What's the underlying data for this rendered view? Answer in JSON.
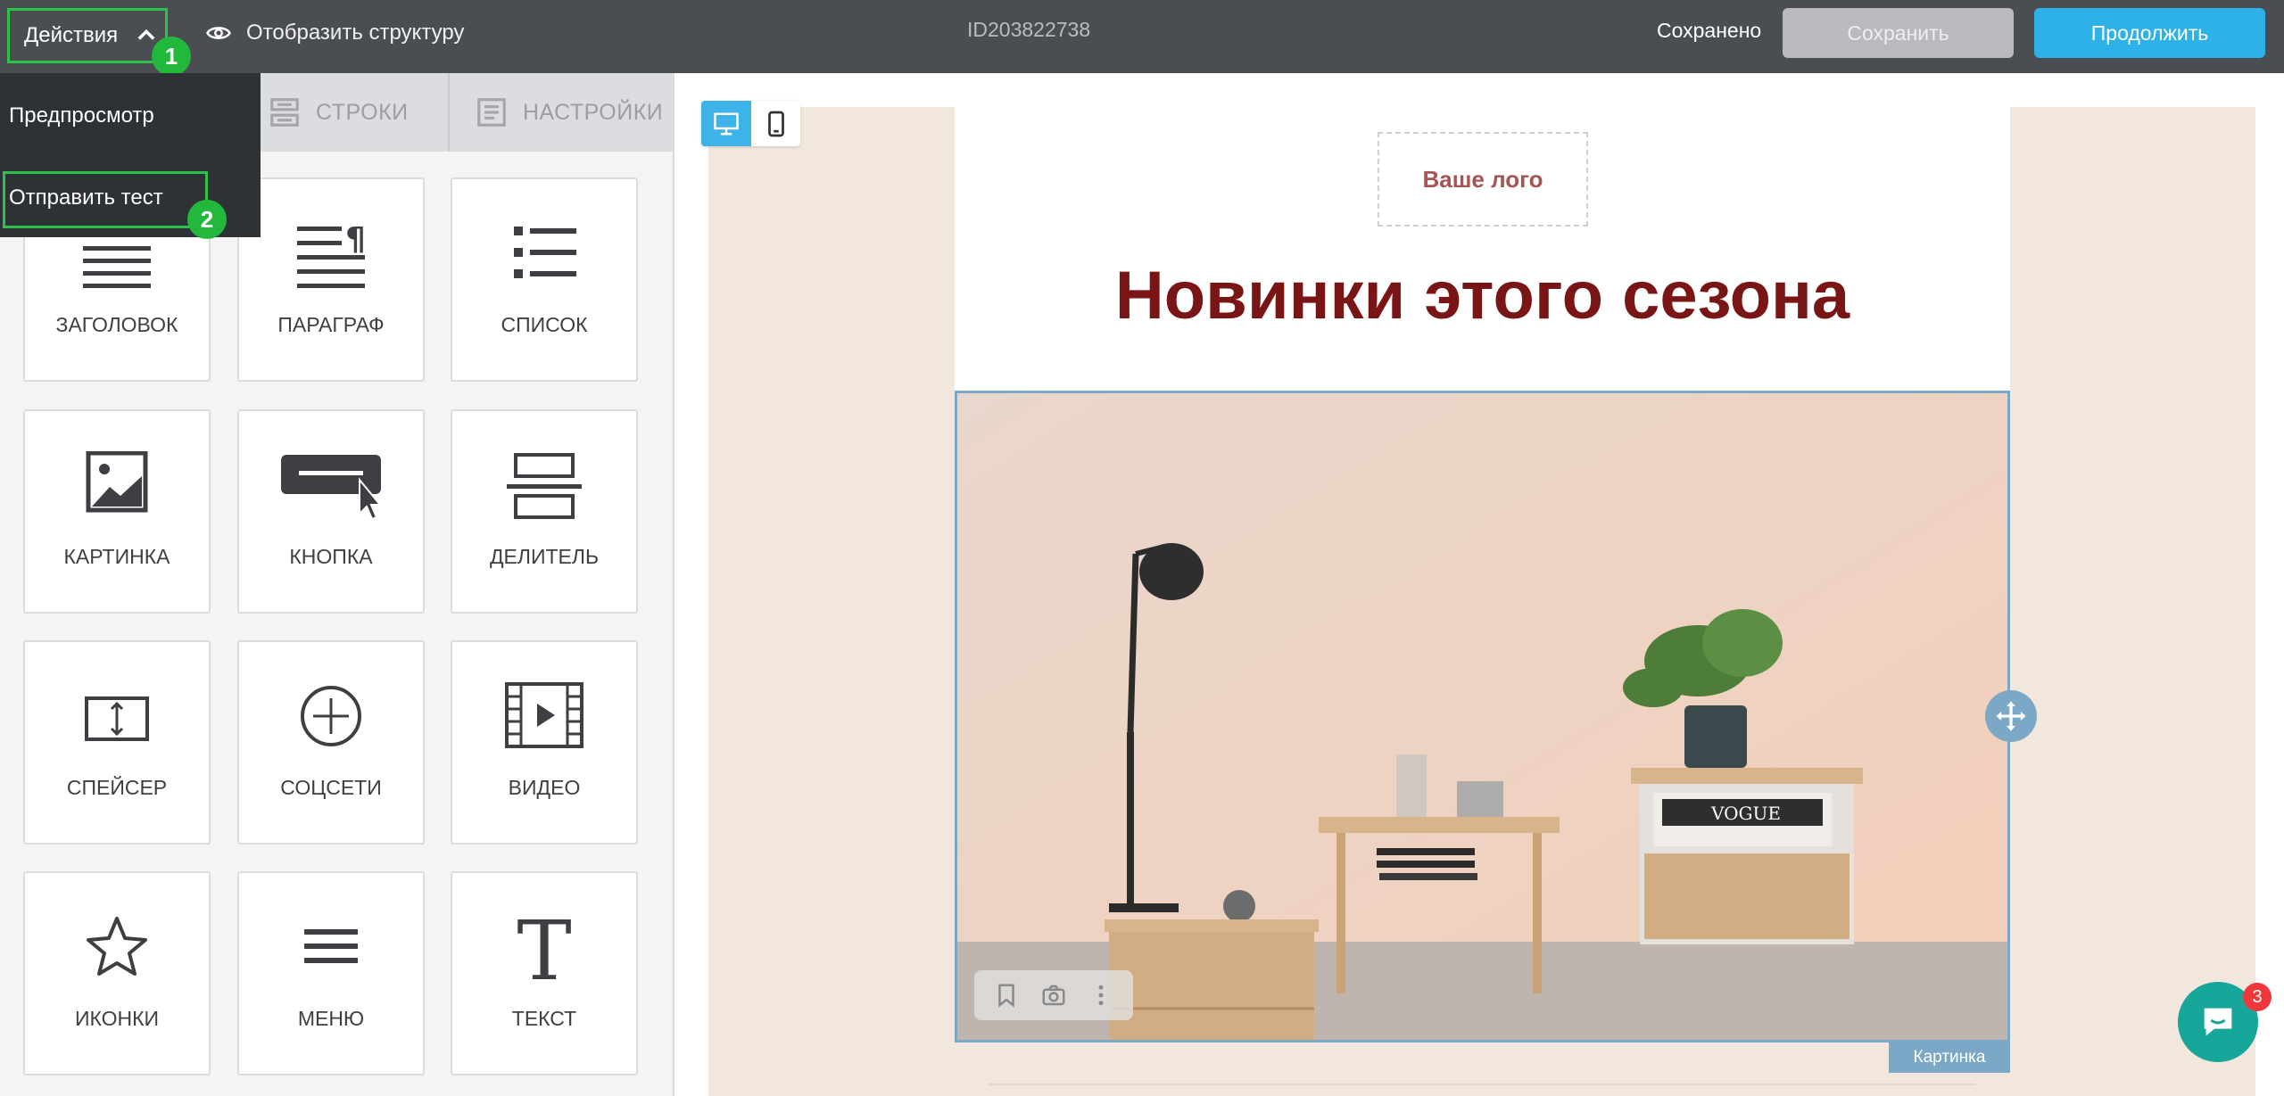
{
  "topbar": {
    "actions_label": "Действия",
    "step1": "1",
    "structure_label": "Отобразить структуру",
    "doc_id": "ID203822738",
    "saved_status": "Сохранено",
    "save_label": "Сохранить",
    "continue_label": "Продолжить"
  },
  "dropdown": {
    "preview_label": "Предпросмотр",
    "send_test_label": "Отправить тест",
    "step2": "2"
  },
  "panel": {
    "tabs": [
      {
        "label": "СТРОКИ",
        "icon": "rows-icon"
      },
      {
        "label": "НАСТРОЙКИ",
        "icon": "settings-icon"
      }
    ],
    "blocks": [
      {
        "label": "ЗАГОЛОВОК",
        "icon": "heading-icon"
      },
      {
        "label": "ПАРАГРАФ",
        "icon": "paragraph-icon"
      },
      {
        "label": "СПИСОК",
        "icon": "list-icon"
      },
      {
        "label": "КАРТИНКА",
        "icon": "image-icon"
      },
      {
        "label": "КНОПКА",
        "icon": "button-icon"
      },
      {
        "label": "ДЕЛИТЕЛЬ",
        "icon": "divider-icon"
      },
      {
        "label": "СПЕЙСЕР",
        "icon": "spacer-icon"
      },
      {
        "label": "СОЦСЕТИ",
        "icon": "social-icon"
      },
      {
        "label": "ВИДЕО",
        "icon": "video-icon"
      },
      {
        "label": "ИКОНКИ",
        "icon": "star-icon"
      },
      {
        "label": "МЕНЮ",
        "icon": "menu-icon"
      },
      {
        "label": "ТЕКСТ",
        "icon": "text-icon"
      }
    ]
  },
  "email": {
    "logo_placeholder": "Ваше лого",
    "headline": "Новинки этого сезона",
    "image_block_label": "Картинка",
    "scene_magazine_text": "VOGUE"
  },
  "chat": {
    "unread_count": "3"
  },
  "colors": {
    "topbar_bg": "#4a4e52",
    "accent_blue": "#2eb1e8",
    "highlight_green": "#2ec24a",
    "headline_red": "#7a1516",
    "selection_blue": "#7ba8c6",
    "canvas_beige": "#f1e7dc"
  }
}
